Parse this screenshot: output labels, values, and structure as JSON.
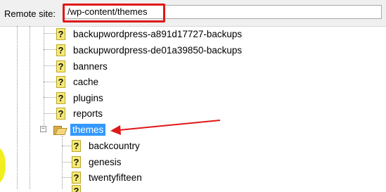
{
  "remote_site": {
    "label": "Remote site:",
    "path": "/wp-content/themes"
  },
  "tree": {
    "items": [
      {
        "name": "backupwordpress-a891d17727-backups",
        "icon": "unknown-folder-icon"
      },
      {
        "name": "backupwordpress-de01a39850-backups",
        "icon": "unknown-folder-icon"
      },
      {
        "name": "banners",
        "icon": "unknown-folder-icon"
      },
      {
        "name": "cache",
        "icon": "unknown-folder-icon"
      },
      {
        "name": "plugins",
        "icon": "unknown-folder-icon"
      },
      {
        "name": "reports",
        "icon": "unknown-folder-icon"
      },
      {
        "name": "themes",
        "icon": "open-folder-icon",
        "selected": true,
        "expanded": true
      },
      {
        "name": "backcountry",
        "icon": "unknown-folder-icon"
      },
      {
        "name": "genesis",
        "icon": "unknown-folder-icon"
      },
      {
        "name": "twentyfifteen",
        "icon": "unknown-folder-icon"
      }
    ]
  },
  "annotation": {
    "highlight_color": "#e01818",
    "selection_color": "#3399ff"
  }
}
